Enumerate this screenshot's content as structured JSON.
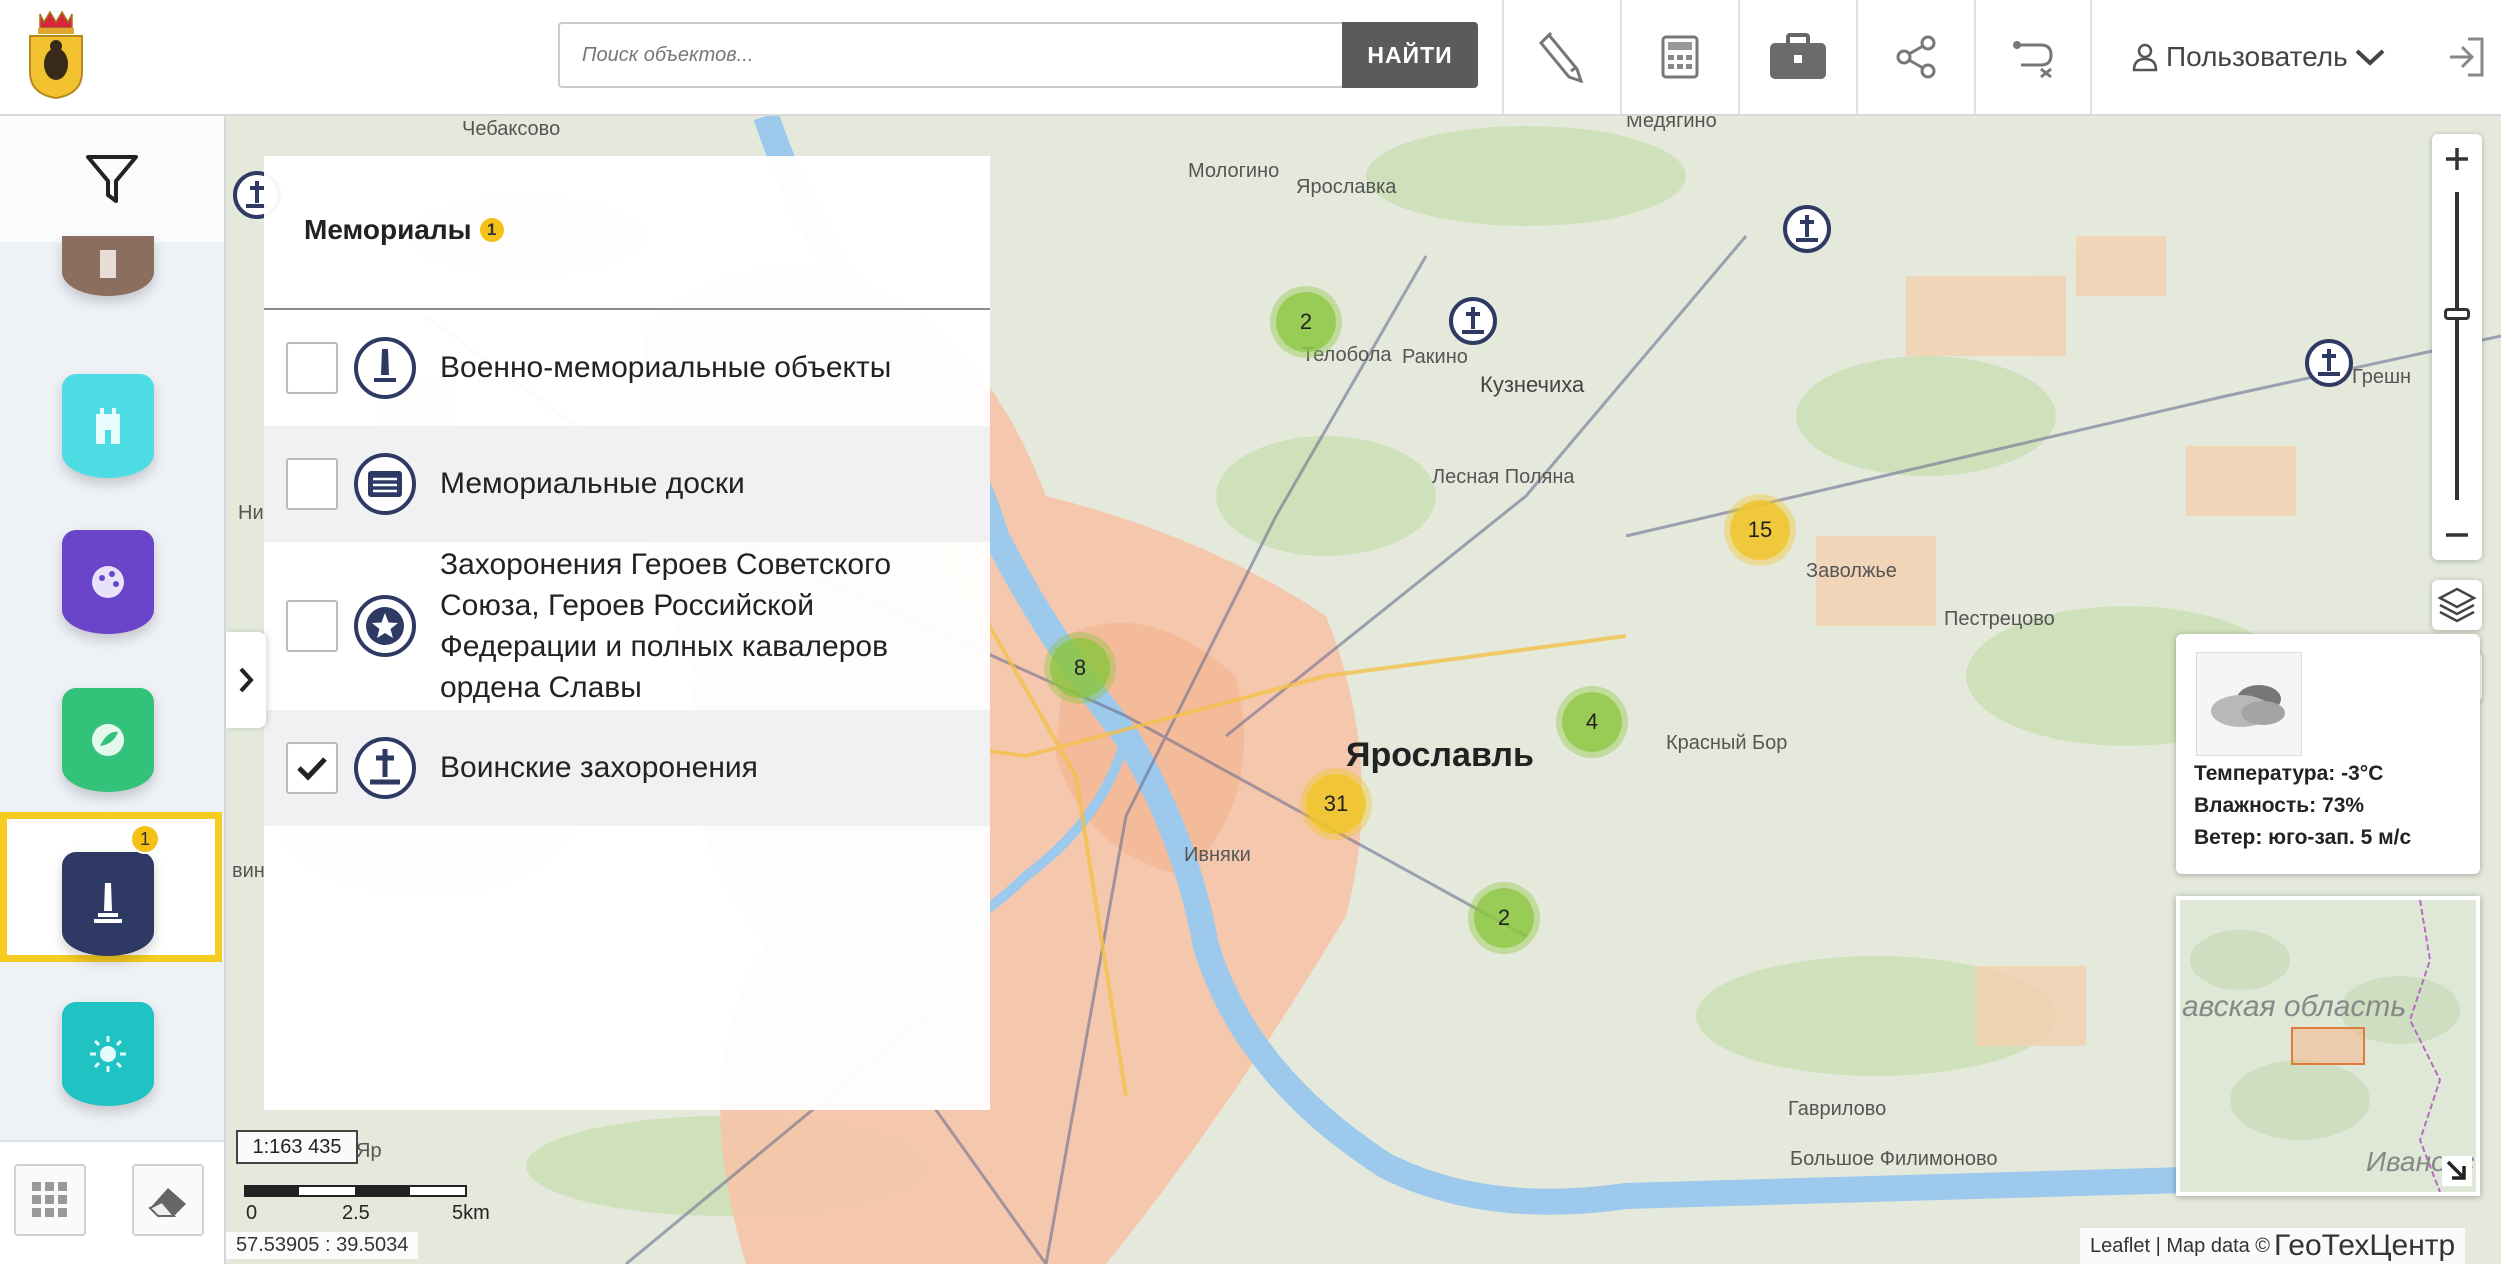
{
  "header": {
    "search": {
      "placeholder": "Поиск объектов...",
      "button_label": "НАЙТИ"
    },
    "user_menu": {
      "label": "Пользователь"
    }
  },
  "panel": {
    "title": "Мемориалы",
    "title_badge": "1",
    "items": [
      {
        "label": "Военно-мемориальные объекты",
        "checked": false,
        "icon": "monument-icon"
      },
      {
        "label": "Мемориальные доски",
        "checked": false,
        "icon": "plaque-icon"
      },
      {
        "label": "Захоронения Героев Советского Союза, Героев Российской Федерации и полных кавалеров ордена Славы",
        "checked": false,
        "icon": "star-medal-icon"
      },
      {
        "label": "Воинские захоронения",
        "checked": true,
        "icon": "military-grave-icon"
      }
    ]
  },
  "sidebar": {
    "active_badge": "1"
  },
  "map": {
    "city_label": "Ярославль",
    "place_labels": [
      "Чебаксово",
      "Медягино",
      "Мологино",
      "Ярославка",
      "Ракино",
      "Телобола",
      "Кузнечиха",
      "Лесная Поляна",
      "Заволжье",
      "Пестрецово",
      "Грешн",
      "Красный Бор",
      "Ивняки",
      "Гаврилово",
      "Большое Филимоново",
      "Ни",
      "вин",
      "Яр"
    ],
    "clusters": [
      "2",
      "15",
      "8",
      "4",
      "31",
      "2"
    ],
    "scale_ratio": "1:163 435",
    "scale_ticks": [
      "0",
      "2.5",
      "5km"
    ],
    "coordinates": "57.53905 : 39.5034",
    "attribution_prefix": "Leaflet | Map data ©",
    "attribution_brand": "ГеоТехЦентр",
    "minimap_labels": [
      "авская область",
      "Ивановс"
    ]
  },
  "weather": {
    "temperature": "Температура: -3°C",
    "humidity": "Влажность: 73%",
    "wind": "Ветер: юго-зап. 5 м/с"
  },
  "colors": {
    "accent_yellow": "#f5c116",
    "cluster_green": "#8cc63f",
    "cluster_yellow": "#f0c42a",
    "river": "#9cc9ec",
    "city": "#f6c4a8"
  }
}
